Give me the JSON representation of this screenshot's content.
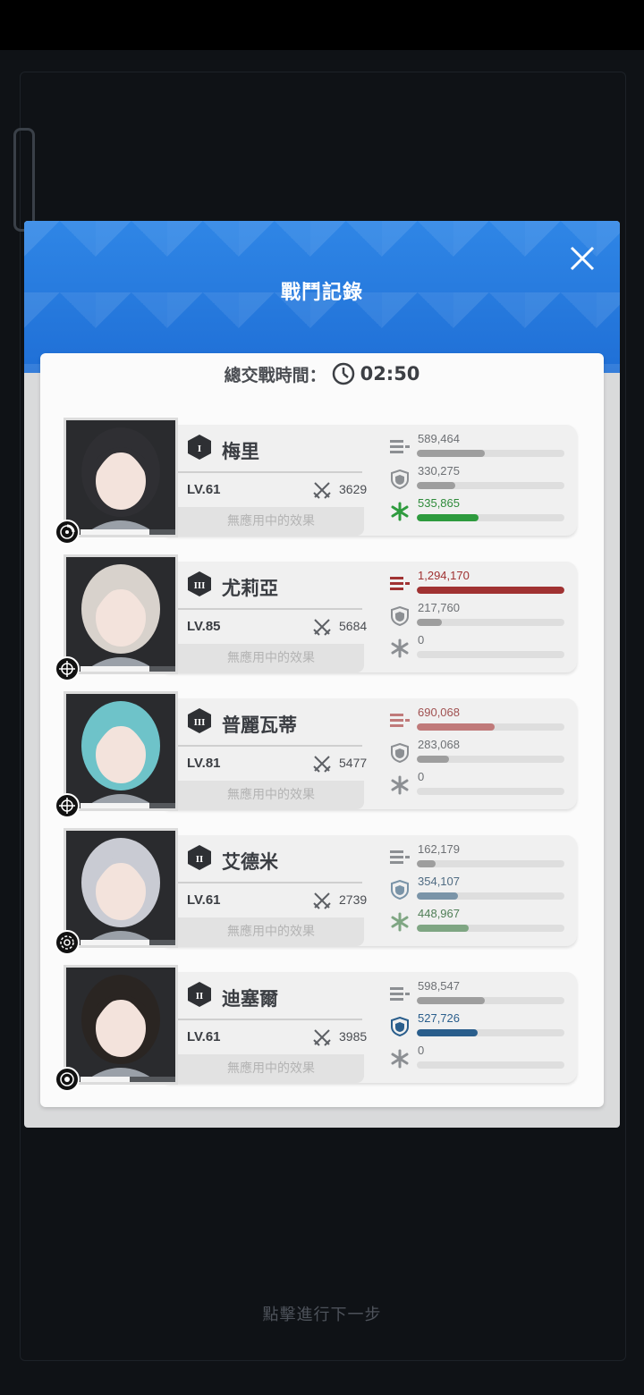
{
  "modal": {
    "title": "戰鬥記錄",
    "total_time_label": "總交戰時間：",
    "total_time_value": "02:50"
  },
  "next_step_text": "點擊進行下一步",
  "characters": [
    {
      "name": "梅里",
      "rank": "I",
      "level": "LV.61",
      "power": "3629",
      "effect": "無應用中的效果",
      "class_icon": "dial-icon",
      "hp_fraction": 0.7,
      "stats": [
        {
          "icon": "damage-dealt-icon",
          "value": "589,464",
          "fraction": 0.46,
          "color": "#9e9e9e",
          "text_color": "#6d7074"
        },
        {
          "icon": "damage-taken-shield-icon",
          "value": "330,275",
          "fraction": 0.26,
          "color": "#9e9e9e",
          "text_color": "#6d7074"
        },
        {
          "icon": "healing-icon",
          "value": "535,865",
          "fraction": 0.42,
          "color": "#2e9b3e",
          "text_color": "#2e8b3a"
        }
      ]
    },
    {
      "name": "尤莉亞",
      "rank": "III",
      "level": "LV.85",
      "power": "5684",
      "effect": "無應用中的效果",
      "class_icon": "crosshair-icon",
      "hp_fraction": 0.7,
      "stats": [
        {
          "icon": "damage-dealt-icon",
          "value": "1,294,170",
          "fraction": 1.0,
          "color": "#a03232",
          "text_color": "#a03232"
        },
        {
          "icon": "damage-taken-shield-icon",
          "value": "217,760",
          "fraction": 0.17,
          "color": "#9e9e9e",
          "text_color": "#6d7074"
        },
        {
          "icon": "healing-icon",
          "value": "0",
          "fraction": 0.0,
          "color": "#9e9e9e",
          "text_color": "#6d7074"
        }
      ]
    },
    {
      "name": "普麗瓦蒂",
      "rank": "III",
      "level": "LV.81",
      "power": "5477",
      "effect": "無應用中的效果",
      "class_icon": "crosshair-icon",
      "hp_fraction": 0.7,
      "stats": [
        {
          "icon": "damage-dealt-icon",
          "value": "690,068",
          "fraction": 0.53,
          "color": "#c07a7a",
          "text_color": "#a05050"
        },
        {
          "icon": "damage-taken-shield-icon",
          "value": "283,068",
          "fraction": 0.22,
          "color": "#9e9e9e",
          "text_color": "#6d7074"
        },
        {
          "icon": "healing-icon",
          "value": "0",
          "fraction": 0.0,
          "color": "#9e9e9e",
          "text_color": "#6d7074"
        }
      ]
    },
    {
      "name": "艾德米",
      "rank": "II",
      "level": "LV.61",
      "power": "2739",
      "effect": "無應用中的效果",
      "class_icon": "gear-target-icon",
      "hp_fraction": 0.7,
      "stats": [
        {
          "icon": "damage-dealt-icon",
          "value": "162,179",
          "fraction": 0.13,
          "color": "#9e9e9e",
          "text_color": "#6d7074"
        },
        {
          "icon": "damage-taken-shield-icon",
          "value": "354,107",
          "fraction": 0.28,
          "color": "#7a94a8",
          "text_color": "#4f6b82"
        },
        {
          "icon": "healing-icon",
          "value": "448,967",
          "fraction": 0.35,
          "color": "#7fa683",
          "text_color": "#4f7e56"
        }
      ]
    },
    {
      "name": "迪塞爾",
      "rank": "II",
      "level": "LV.61",
      "power": "3985",
      "effect": "無應用中的效果",
      "class_icon": "defender-icon",
      "hp_fraction": 0.5,
      "stats": [
        {
          "icon": "damage-dealt-icon",
          "value": "598,547",
          "fraction": 0.46,
          "color": "#9e9e9e",
          "text_color": "#6d7074"
        },
        {
          "icon": "damage-taken-shield-icon",
          "value": "527,726",
          "fraction": 0.41,
          "color": "#2a5e8c",
          "text_color": "#2a5e8c"
        },
        {
          "icon": "healing-icon",
          "value": "0",
          "fraction": 0.0,
          "color": "#9e9e9e",
          "text_color": "#6d7074"
        }
      ]
    }
  ]
}
